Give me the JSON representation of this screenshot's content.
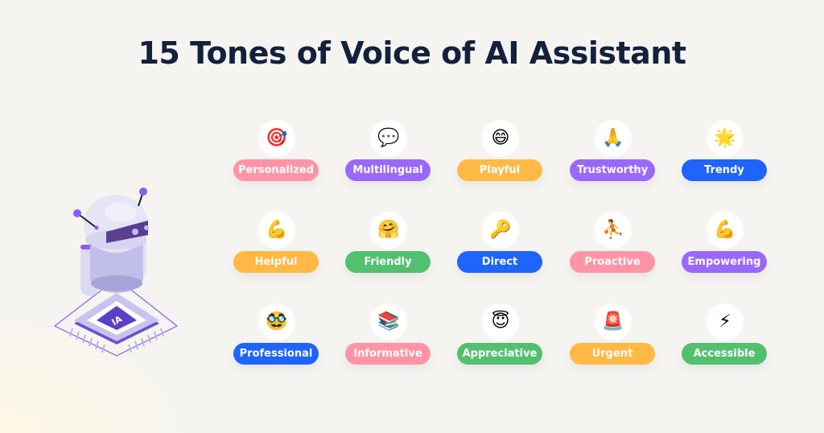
{
  "title": "15 Tones of Voice of AI Assistant",
  "illustration": {
    "chip_label": "IA"
  },
  "colors": {
    "pink": "#ff94a6",
    "purple": "#9a68fa",
    "orange": "#ffb944",
    "blue": "#1f64fb",
    "green": "#53c06f",
    "title": "#14213d"
  },
  "tones": [
    {
      "label": "Personalized",
      "icon": "direct-hit-icon",
      "emoji": "🎯",
      "color": "#ff94a6"
    },
    {
      "label": "Multilingual",
      "icon": "speech-bubble-icon",
      "emoji": "💬",
      "color": "#9a68fa"
    },
    {
      "label": "Playful",
      "icon": "grinning-face-icon",
      "emoji": "😄",
      "color": "#ffb944"
    },
    {
      "label": "Trustworthy",
      "icon": "folded-hands-icon",
      "emoji": "🙏",
      "color": "#9a68fa"
    },
    {
      "label": "Trendy",
      "icon": "glowing-star-icon",
      "emoji": "🌟",
      "color": "#1f64fb"
    },
    {
      "label": "Helpful",
      "icon": "flexed-biceps-icon",
      "emoji": "💪",
      "color": "#ffb944"
    },
    {
      "label": "Friendly",
      "icon": "hugging-face-icon",
      "emoji": "🤗",
      "color": "#53c06f"
    },
    {
      "label": "Direct",
      "icon": "key-icon",
      "emoji": "🔑",
      "color": "#1f64fb"
    },
    {
      "label": "Proactive",
      "icon": "person-bouncing-ball-icon",
      "emoji": "⛹",
      "color": "#ff94a6"
    },
    {
      "label": "Empowering",
      "icon": "flexed-biceps-icon",
      "emoji": "💪",
      "color": "#9a68fa"
    },
    {
      "label": "Professional",
      "icon": "disguised-glasses-face-icon",
      "emoji": "🥸",
      "color": "#1f64fb"
    },
    {
      "label": "Informative",
      "icon": "books-icon",
      "emoji": "📚",
      "color": "#ff94a6"
    },
    {
      "label": "Appreciative",
      "icon": "smiling-face-halo-icon",
      "emoji": "😇",
      "color": "#53c06f"
    },
    {
      "label": "Urgent",
      "icon": "police-light-icon",
      "emoji": "🚨",
      "color": "#ffb944"
    },
    {
      "label": "Accessible",
      "icon": "high-voltage-icon",
      "emoji": "⚡",
      "color": "#53c06f"
    }
  ]
}
